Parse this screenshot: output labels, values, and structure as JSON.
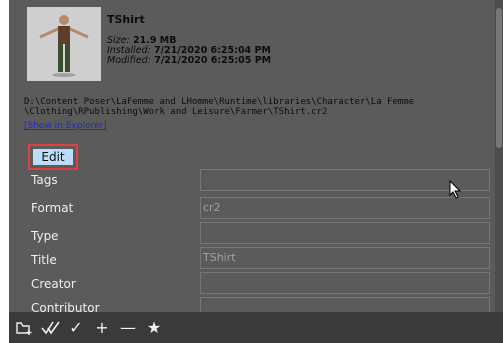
{
  "item": {
    "name": "TShirt",
    "size_label": "Size:",
    "size_value": "21.9 MB",
    "installed_label": "Installed:",
    "installed_value": "7/21/2020 6:25:04 PM",
    "modified_label": "Modified:",
    "modified_value": "7/21/2020 6:25:05 PM",
    "path_line1": "D:\\Content Poser\\LaFemme and LHomme\\Runtime\\libraries\\Character\\La Femme",
    "path_line2": "\\Clothing\\RPublishing\\Work and Leisure\\Farmer\\TShirt.cr2",
    "show_in_explorer": "[Show in Explorer]"
  },
  "edit_label": "Edit",
  "fields": [
    {
      "label": "Tags",
      "value": ""
    },
    {
      "label": "Format",
      "value": "cr2"
    },
    {
      "label": "Type",
      "value": ""
    },
    {
      "label": "Title",
      "value": "TShirt"
    },
    {
      "label": "Creator",
      "value": ""
    },
    {
      "label": "Contributor",
      "value": ""
    }
  ],
  "toolbar": {
    "icons": [
      "folder-add-icon",
      "check-all-icon",
      "check-icon",
      "plus-icon",
      "minus-icon",
      "star-icon"
    ],
    "glyph_check": "✓",
    "glyph_plus": "+",
    "glyph_minus": "—",
    "glyph_star": "★"
  }
}
